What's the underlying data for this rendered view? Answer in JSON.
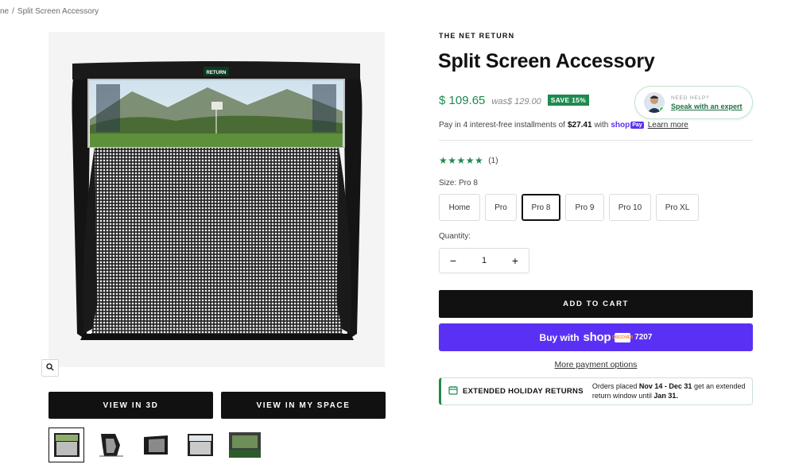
{
  "breadcrumb": {
    "home": "ne",
    "separator": "/",
    "current": "Split Screen Accessory"
  },
  "gallery": {
    "zoom_icon": "magnifier-icon",
    "view_3d_label": "VIEW IN 3D",
    "view_space_label": "VIEW IN MY SPACE",
    "thumbnails": [
      "net-front",
      "net-side",
      "net-angled",
      "net-front-alt",
      "indoor-room"
    ]
  },
  "product": {
    "vendor": "THE NET RETURN",
    "title": "Split Screen Accessory",
    "price": "$ 109.65",
    "was_label": "was$ 129.00",
    "save_badge": "SAVE 15%",
    "installments_prefix": "Pay in 4 interest-free installments of",
    "installments_amount": "$27.41",
    "installments_with": "with",
    "shop_pay_word": "shop",
    "shop_pay_badge": "Pay",
    "learn_more": "Learn more",
    "stars": "★★★★★",
    "review_count": "(1)",
    "size_label": "Size:",
    "size_selected": "Pro 8",
    "sizes": [
      "Home",
      "Pro",
      "Pro 8",
      "Pro 9",
      "Pro 10",
      "Pro XL"
    ],
    "quantity_label": "Quantity:",
    "quantity_value": "1",
    "minus": "−",
    "plus": "+",
    "add_to_cart": "ADD TO CART",
    "buy_with": "Buy with",
    "buy_shop_word": "shop",
    "card_brand": "DISCOVER",
    "card_last4": "7207",
    "more_payment": "More payment options"
  },
  "holiday": {
    "title": "EXTENDED HOLIDAY RETURNS",
    "text_1": "Orders placed",
    "dates": "Nov 14 - Dec 31",
    "text_2": "get an extended return window until",
    "until": "Jan 31."
  },
  "help_chip": {
    "small": "NEED HELP?",
    "link": "Speak with an expert"
  },
  "colors": {
    "accent_green": "#1e8a4f",
    "shop_purple": "#5a31f4",
    "button_black": "#111111"
  }
}
